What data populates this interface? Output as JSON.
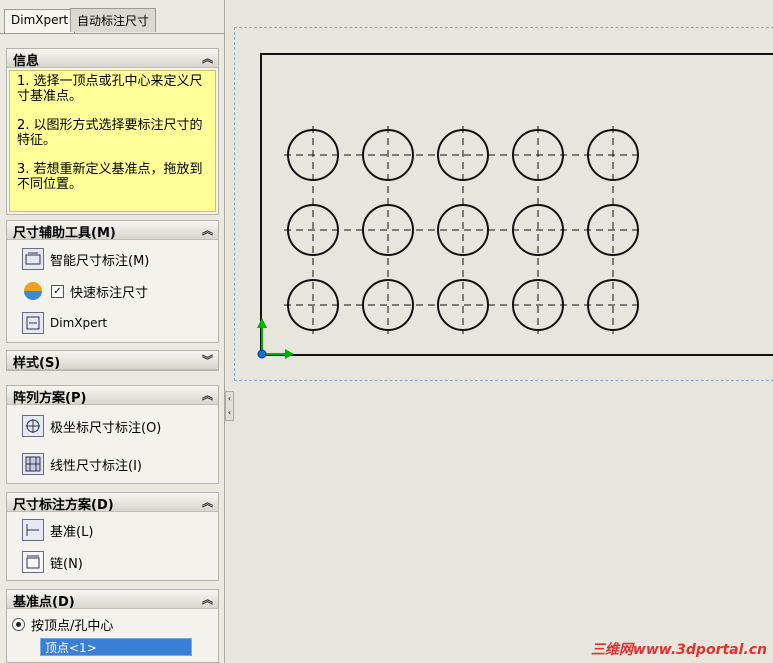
{
  "tabs": [
    "DimXpert",
    "自动标注尺寸"
  ],
  "info": {
    "title": "信息",
    "lines": [
      "1. 选择一顶点或孔中心来定义尺寸基准点。",
      "2. 以图形方式选择要标注尺寸的特征。",
      "3. 若想重新定义基准点，拖放到不同位置。"
    ]
  },
  "tools": {
    "title": "尺寸辅助工具(M)",
    "smart_dim": "智能尺寸标注(M)",
    "quick_dim": "快速标注尺寸",
    "quick_dim_checked": true,
    "dimxpert": "DimXpert"
  },
  "style": {
    "title": "样式(S)"
  },
  "pattern": {
    "title": "阵列方案(P)",
    "polar": "极坐标尺寸标注(O)",
    "linear": "线性尺寸标注(I)"
  },
  "scheme": {
    "title": "尺寸标注方案(D)",
    "baseline": "基准(L)",
    "chain": "链(N)"
  },
  "datum": {
    "title": "基准点(D)",
    "option": "按顶点/孔中心",
    "selected": "顶点<1>"
  },
  "holes": {
    "rows": 3,
    "cols": 5
  },
  "watermark": "三维网www.3dportal.cn",
  "colors": {
    "info_bg": "#ffff99",
    "selection": "#3a7fd6",
    "axis_x": "#00b000",
    "axis_y": "#00b000"
  }
}
